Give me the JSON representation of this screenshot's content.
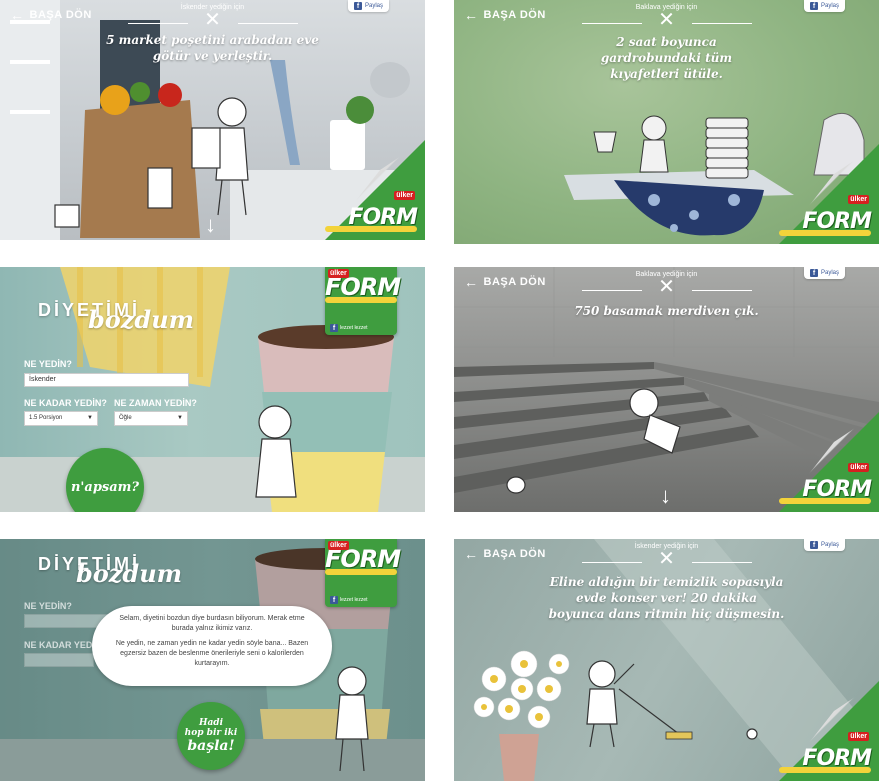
{
  "common": {
    "back_label": "BAŞA DÖN",
    "share_label": "Paylaş",
    "brand_word": "FORM",
    "brand_maker": "ülker",
    "brand_sub": "lezzet",
    "fb_like": "lezzet lezzet"
  },
  "panel1": {
    "who": "İskender yediğin için",
    "task": "5 market poşetini arabadan eve götür ve yerleştir."
  },
  "panel2": {
    "who": "Baklava yediğin için",
    "task": "2 saat boyunca gardrobundaki tüm kıyafetleri ütüle."
  },
  "panel3": {
    "title_line1": "DİYETİMİ",
    "title_line2": "bozdum",
    "what_label": "NE YEDİN?",
    "what_value": "İskender",
    "how_much_label": "NE KADAR YEDİN?",
    "how_much_value": "1.5 Porsiyon",
    "when_label": "NE ZAMAN YEDİN?",
    "when_value": "Öğle",
    "submit_label": "n'apsam?"
  },
  "panel4": {
    "who": "Baklava yediğin için",
    "task": "750 basamak merdiven çık."
  },
  "panel5": {
    "title_line1": "DİYETİMİ",
    "title_line2": "bozdum",
    "what_label": "NE YEDİN?",
    "how_much_label": "NE KADAR YEDİN?",
    "bubble_p1": "Selam, diyetini bozdun diye burdasın biliyorum. Merak etme burada yalnız ikimiz varız.",
    "bubble_p2": "Ne yedin, ne zaman yedin ne kadar yedin söyle bana... Bazen egzersiz bazen de beslenme önerileriyle seni o kalorilerden kurtarayım.",
    "cta_line1": "Hadi",
    "cta_line2": "hop bir iki",
    "cta_line3": "başla!"
  },
  "panel6": {
    "who": "İskender yediğin için",
    "task": "Eline aldığın bir temizlik sopasıyla evde konser ver! 20 dakika boyunca dans ritmin hiç düşmesin."
  },
  "colors": {
    "brand_green": "#3f9d3f",
    "ribbon_yellow": "#f3d33a",
    "ulker_red": "#d62020",
    "facebook_blue": "#3b5998"
  }
}
